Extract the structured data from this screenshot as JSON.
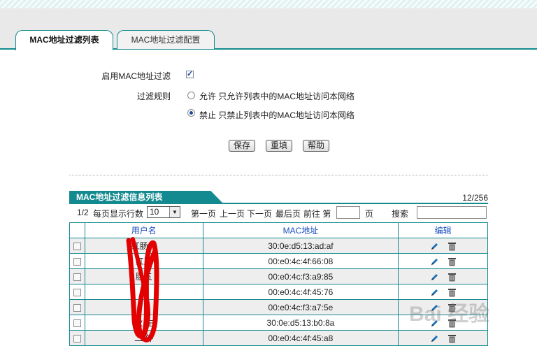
{
  "tabs": [
    {
      "label": "MAC地址过滤列表",
      "active": true
    },
    {
      "label": "MAC地址过滤配置",
      "active": false
    }
  ],
  "form": {
    "enable_label": "启用MAC地址过滤",
    "enable_checked": true,
    "rule_label": "过滤规则",
    "allow_option": "允许 只允许列表中的MAC地址访问本网络",
    "deny_option": "禁止 只禁止列表中的MAC地址访问本网络",
    "selected_rule": "deny"
  },
  "buttons": {
    "save": "保存",
    "reset": "重填",
    "help": "帮助"
  },
  "list": {
    "title": "MAC地址过滤信息列表",
    "count": "12/256",
    "pager": {
      "page": "1/2",
      "per_page_label": "每页显示行数",
      "per_page_value": "10",
      "first": "第一页",
      "prev": "上一页",
      "next": "下一页",
      "last": "最后页",
      "goto_label": "前往 第",
      "page_suffix": "页",
      "search_label": "搜索"
    },
    "columns": {
      "user": "用户名",
      "mac": "MAC地址",
      "edit": "编辑"
    },
    "rows": [
      {
        "user": "红肠一",
        "mac": "30:0e:d5:13:ad:af"
      },
      {
        "user": "红肠",
        "mac": "00:e0:4c:4f:66:08"
      },
      {
        "user": "肠五",
        "mac": "00:e0:4c:f3:a9:85"
      },
      {
        "user": "内",
        "mac": "00:e0:4c:4f:45:76"
      },
      {
        "user": "",
        "mac": "00:e0:4c:f3:a7:5e"
      },
      {
        "user": "伙 左",
        "mac": "30:0e:d5:13:b0:8a"
      },
      {
        "user": "二 外",
        "mac": "00:e0:4c:4f:45:a8"
      }
    ]
  },
  "watermark": "Bai 经验",
  "colors": {
    "accent": "#138a8f",
    "header_text": "#1a4fc0"
  }
}
